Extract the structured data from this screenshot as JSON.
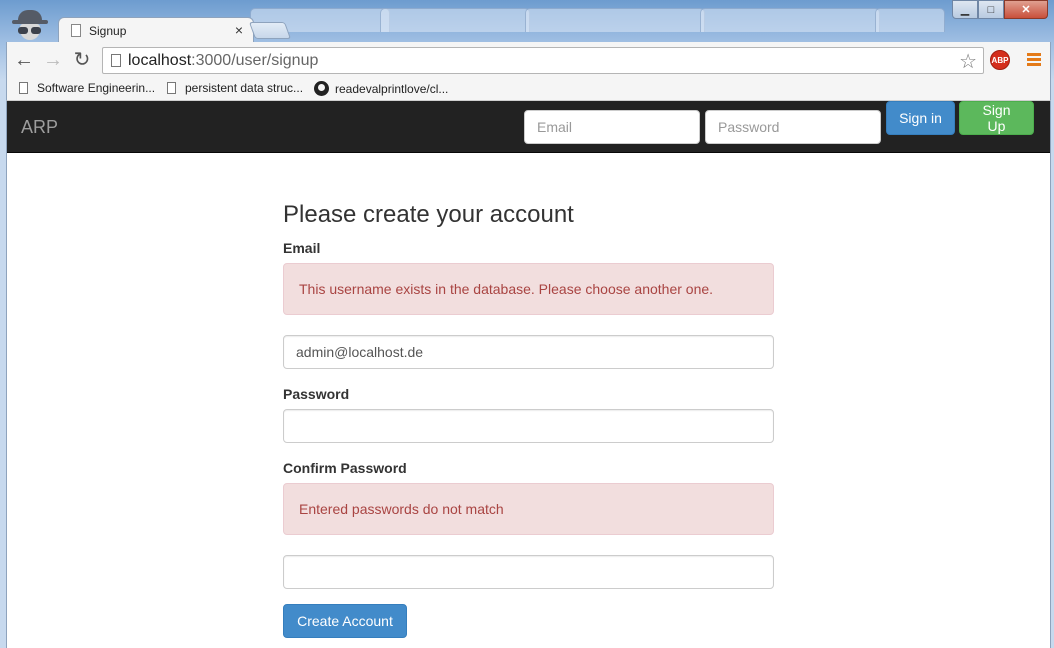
{
  "browser": {
    "tab_title": "Signup",
    "tab_close": "×",
    "url_host": "localhost",
    "url_path": ":3000/user/signup",
    "adblock_label": "ABP",
    "bookmarks": [
      {
        "label": "Software Engineerin..."
      },
      {
        "label": "persistent data struc..."
      },
      {
        "label": "readevalprintlove/cl..."
      }
    ]
  },
  "navbar": {
    "brand": "ARP",
    "email_placeholder": "Email",
    "password_placeholder": "Password",
    "signin_label": "Sign in",
    "signup_label": "Sign Up",
    "bg_color": "#222222"
  },
  "form": {
    "heading": "Please create your account",
    "email_label": "Email",
    "email_error": "This username exists in the database. Please choose another one.",
    "email_value": "admin@localhost.de",
    "password_label": "Password",
    "password_value": "",
    "confirm_label": "Confirm Password",
    "confirm_error": "Entered passwords do not match",
    "confirm_value": "",
    "submit_label": "Create Account"
  },
  "colors": {
    "primary": "#428bca",
    "success": "#5cb85c",
    "alert_bg": "#f2dede",
    "alert_text": "#a94442"
  }
}
